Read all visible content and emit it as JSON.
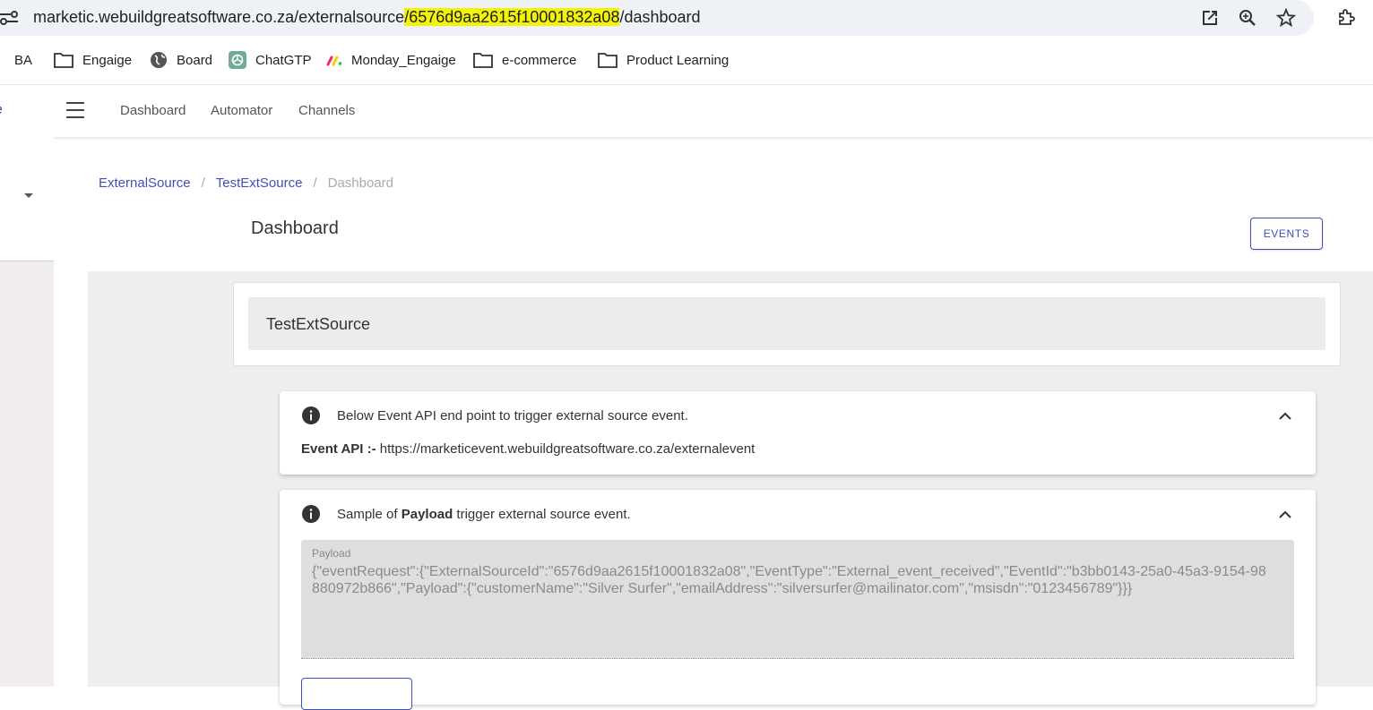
{
  "browser": {
    "url_prefix": "marketic.webuildgreatsoftware.co.za/externalsource",
    "url_highlight": "/6576d9aa2615f10001832a08",
    "url_suffix": "/dashboard",
    "icons": [
      "site-info-icon",
      "open-external-icon",
      "zoom-icon",
      "star-icon",
      "extensions-icon"
    ]
  },
  "bookmarks": [
    {
      "label": "BA",
      "icon": "folder-icon"
    },
    {
      "label": "Engaige",
      "icon": "folder-icon"
    },
    {
      "label": "Board",
      "icon": "globe-icon"
    },
    {
      "label": "ChatGTP",
      "icon": "chatgpt-icon"
    },
    {
      "label": "Monday_Engaige",
      "icon": "monday-icon"
    },
    {
      "label": "e-commerce",
      "icon": "folder-icon"
    },
    {
      "label": "Product Learning",
      "icon": "folder-icon"
    }
  ],
  "appbar": {
    "brand_fragment": "e",
    "nav": [
      "Dashboard",
      "Automator",
      "Channels"
    ]
  },
  "breadcrumb": {
    "items": [
      "ExternalSource",
      "TestExtSource"
    ],
    "current": "Dashboard"
  },
  "page": {
    "title": "Dashboard",
    "events_button": "EVENTS"
  },
  "source": {
    "name": "TestExtSource"
  },
  "api_panel": {
    "heading": "Below Event API end point to trigger external source event.",
    "api_label": "Event API :-",
    "api_url": "https://marketicevent.webuildgreatsoftware.co.za/externalevent"
  },
  "payload_panel": {
    "heading_pre": "Sample of ",
    "heading_bold": "Payload",
    "heading_post": " trigger external source event.",
    "field_label": "Payload",
    "field_value": "{\"eventRequest\":{\"ExternalSourceId\":\"6576d9aa2615f10001832a08\",\"EventType\":\"External_event_received\",\"EventId\":\"b3bb0143-25a0-45a3-9154-98880972b866\",\"Payload\":{\"customerName\":\"Silver Surfer\",\"emailAddress\":\"silversurfer@mailinator.com\",\"msisdn\":\"0123456789\"}}}"
  },
  "colors": {
    "accent": "#3f51b5",
    "url_highlight": "#f3f307",
    "content_bg": "#eeeeee"
  }
}
